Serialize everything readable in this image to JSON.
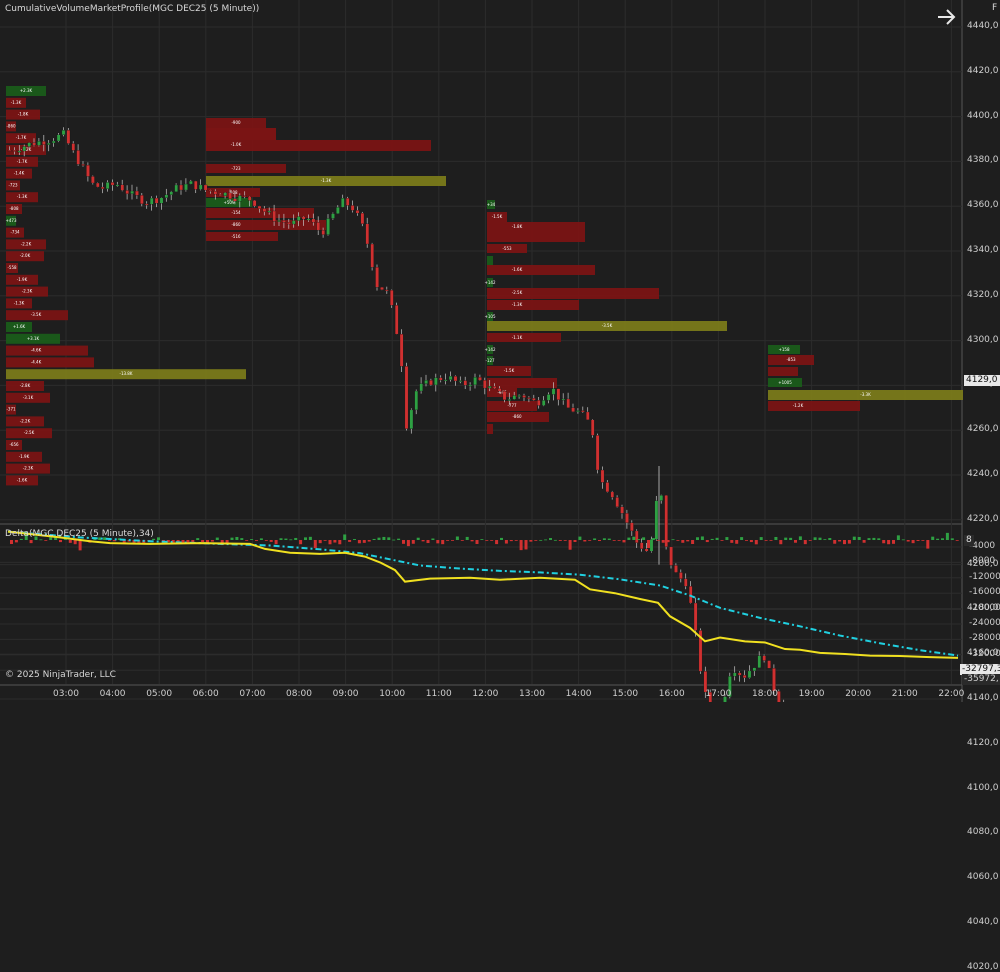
{
  "chart": {
    "title": "CumulativeVolumeMarketProfile(MGC DEC25 (5 Minute))",
    "copyright": "© 2025 NinjaTrader, LLC",
    "corner_label": "F",
    "arrow_icon": "arrow-right-icon",
    "current_price_label": "4129,0",
    "colors": {
      "background": "#1e1e1e",
      "grid": "#2c2c2c",
      "up_candle": "#2ea043",
      "down_candle": "#d03030",
      "profile_sell": "#7a1414",
      "profile_buy": "#1a5c1a",
      "poc": "#7a7a1a",
      "delta_line": "#f0e020",
      "delta_ma": "#20d0e0"
    }
  },
  "price_axis": {
    "labels": [
      "4440,0",
      "4420,0",
      "4400,0",
      "4380,0",
      "4360,0",
      "4340,0",
      "4320,0",
      "4300,0",
      "4280,0",
      "4260,0",
      "4240,0",
      "4220,0",
      "4200,0",
      "4180,0",
      "4160,0",
      "4140,0",
      "4120,0",
      "4100,0",
      "4080,0",
      "4060,0",
      "4040,0",
      "4020,0"
    ]
  },
  "time_axis": {
    "labels": [
      "03:00",
      "04:00",
      "05:00",
      "06:00",
      "07:00",
      "08:00",
      "09:00",
      "10:00",
      "11:00",
      "12:00",
      "13:00",
      "14:00",
      "15:00",
      "16:00",
      "17:00",
      "18:00",
      "19:00",
      "20:00",
      "21:00",
      "22:00"
    ]
  },
  "delta_panel": {
    "title": "Delta(MGC DEC25 (5 Minute),34)",
    "axis_labels": [
      "-4000",
      "-8000",
      "-12000",
      "-16000",
      "-20000",
      "-24000",
      "-28000",
      "-32000",
      "-36000"
    ],
    "top_label": "8",
    "last_value_label": "-32797,3",
    "last_value_label_2": "-35972,"
  },
  "profiles": [
    {
      "name": "overnight-profile",
      "labels": [
        "+2.3K",
        "-1.3K",
        "-1.8K",
        "-860",
        "-1.7K",
        "-2.2K",
        "-1.7K",
        "-1.4K",
        "-723",
        "-1.3K",
        "-808",
        "+473",
        "-734",
        "-2.2K",
        "-2.0K",
        "-558",
        "-1.9K",
        "-2.3K",
        "-1.3K",
        "-3.5K",
        "+1.6K",
        "+3.1K",
        "-4.6K",
        "-4.4K",
        "-13.8K",
        "-2.8K",
        "-3.1K",
        "-371",
        "-2.2K",
        "-2.5K",
        "-656",
        "-1.9K",
        "-2.3K",
        "-1.6K"
      ]
    },
    {
      "name": "morning-profile",
      "labels": [
        "-900",
        "-1.0K",
        "-1.7K",
        "-723",
        "-1.3K",
        "-808",
        "+509",
        "-154",
        "-860",
        "-516"
      ]
    },
    {
      "name": "midday-profile",
      "labels": [
        "+34",
        "-1.5K",
        "-1.8K",
        "-553",
        "-1.6K",
        "+142",
        "-2.5K",
        "-1.3K",
        "+105",
        "-3.5K",
        "-1.1K",
        "+142",
        "-127",
        "-1.5K",
        "-946",
        "-777",
        "-860"
      ]
    },
    {
      "name": "evening-profile",
      "labels": [
        "+158",
        "-853",
        "+1005",
        "-3.3K",
        "-1.2K"
      ]
    }
  ]
}
